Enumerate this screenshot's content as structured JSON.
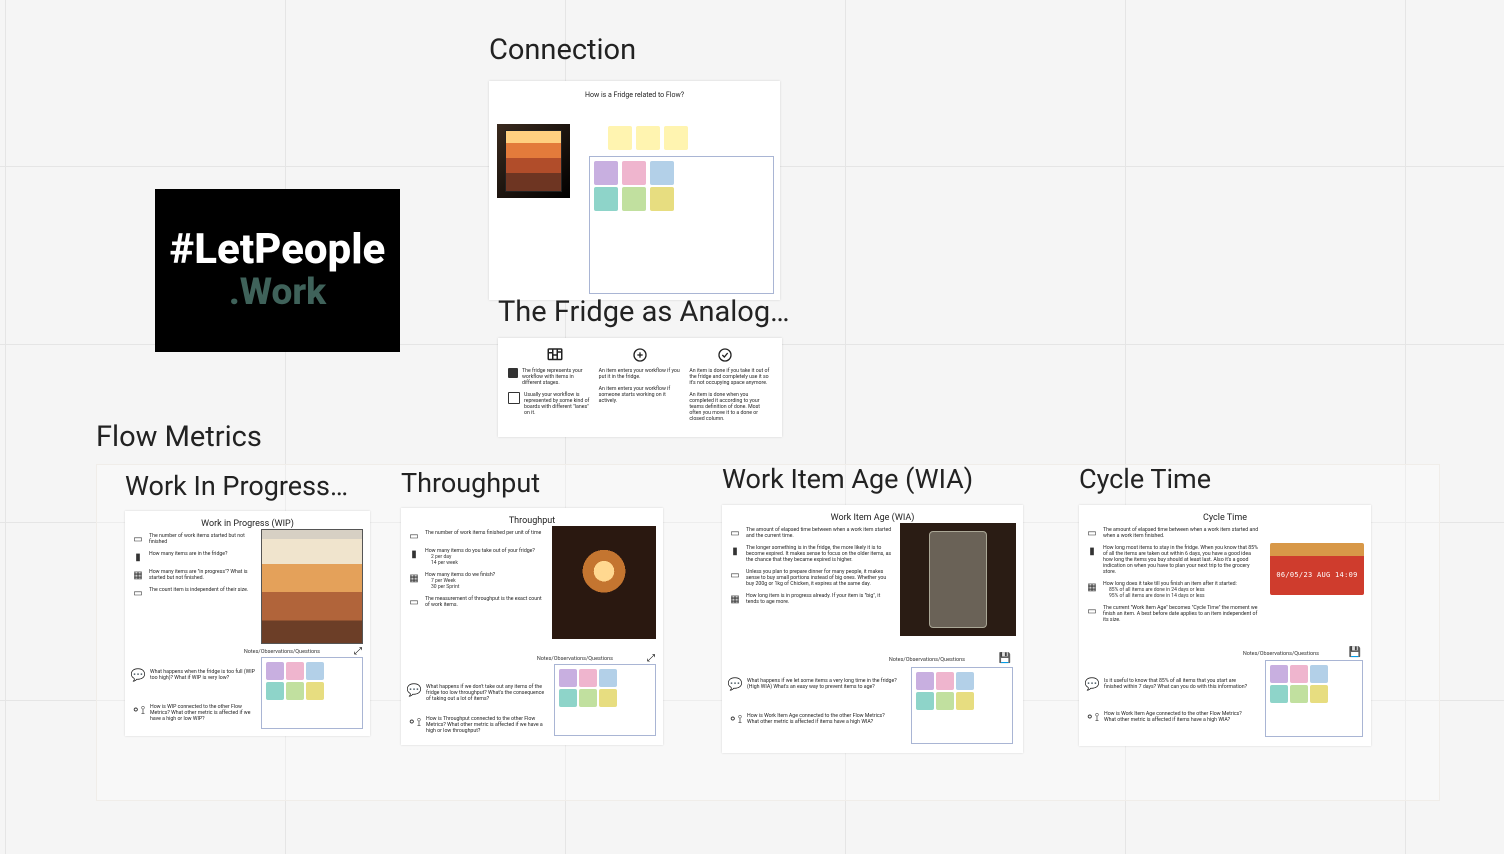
{
  "logo": {
    "line1": "#LetPeople",
    "line2": ".Work"
  },
  "sections": {
    "connection": "Connection",
    "analogy": "The Fridge as Analog…",
    "flow": "Flow Metrics"
  },
  "connection": {
    "header": "How is a Fridge related to Flow?"
  },
  "analogy": {
    "col1a": "The fridge represents your workflow with items in different stages.",
    "col1b": "Usually your workflow is represented by some kind of boards with different \"lanes\" on it.",
    "col2a": "An item enters your workflow if you put it in the fridge.",
    "col2b": "An item enters your workflow if someone starts working on it actively.",
    "col3a": "An item is done if you take it out of the fridge and completely use it so it's not occupying space anymore.",
    "col3b": "An item is done when you completed it according to your teams definition of done. Most often you move it to a done or closed column."
  },
  "metrics": {
    "wip": {
      "heading": "Work In Progress…",
      "title": "Work in Progress (WIP)",
      "b1": "The number of work items started but not finished",
      "b2": "How many items are in the fridge?",
      "b3": "How many items are \"in progress\"? What is started but not finished.",
      "b4": "The count item is independent of their size.",
      "q1": "What happens when the fridge is too full (WIP too high)? What if WIP is very low?",
      "q2": "How is WIP connected to the other Flow Metrics? What other metric is affected if we have a high or low WIP?",
      "notes": "Notes/Observations/Questions"
    },
    "tp": {
      "heading": "Throughput",
      "title": "Throughput",
      "b1": "The number of work items finished per unit of time",
      "b2": "How many items do you take out of your fridge?",
      "b2s": "2 per day\n14 per week",
      "b3": "How many items do we finish?",
      "b3s": "7 per Week\n30 per Sprint",
      "b4": "The measurement of throughput is the exact count of work items.",
      "q1": "What happens if we don't take out any items of the fridge too low throughput? What's the consequence of taking out a lot of items?",
      "q2": "How is Throughput connected to the other Flow Metrics? What other metric is affected if we have a high or low throughput?",
      "notes": "Notes/Observations/Questions"
    },
    "wia": {
      "heading": "Work Item Age (WIA)",
      "title": "Work Item Age (WIA)",
      "b1": "The amount of elapsed time between when a work item started and the current time.",
      "b2": "The longer something is in the fridge, the more likely it is to become expired. It makes sense to focus on the older items, as the chance that they became expired is higher.",
      "b3": "Unless you plan to prepare dinner for many people, it makes sense to buy small portions instead of big ones. Whether you buy 200g or 1kg of Chicken, it expires at the same day.",
      "b4": "How long item is in progress already. If your item is \"big\", it tends to age more.",
      "q1": "What happens if we let some items a very long time in the fridge? (High WIA) What's an easy way to prevent items to age?",
      "q2": "How is Work Item Age connected to the other Flow Metrics? What other metric is affected if items have a high WIA?",
      "notes": "Notes/Observations/Questions"
    },
    "ct": {
      "heading": "Cycle Time",
      "title": "Cycle Time",
      "b1": "The amount of elapsed time between when a work item started and when a work item finished.",
      "b2": "How long most items to stay in the fridge. When you know that 85% of all the items are taken out within 6 days, you have a good idea how long the items you buy should at least last. Also it's a good indication on when you have to plan your next trip to the grocery store.",
      "b3": "How long does it take till you finish an item after it started:",
      "b3s": "85% of all items are done in 24 days or less\n95% of all items are done in 14 days or less",
      "b4": "The current \"Work Item Age\" becomes \"Cycle Time\" the moment we finish an item. A best before date applies to an item independent of its size.",
      "stamp": "06/05/23 AUG 14:09",
      "q1": "Is it useful to know that 85% of all items that you start are finished within 7 days? What can you do with this information?",
      "q2": "How is Work Item Age connected to the other Flow Metrics? What other metric is affected if items have a high WIA?",
      "notes": "Notes/Observations/Questions"
    }
  }
}
